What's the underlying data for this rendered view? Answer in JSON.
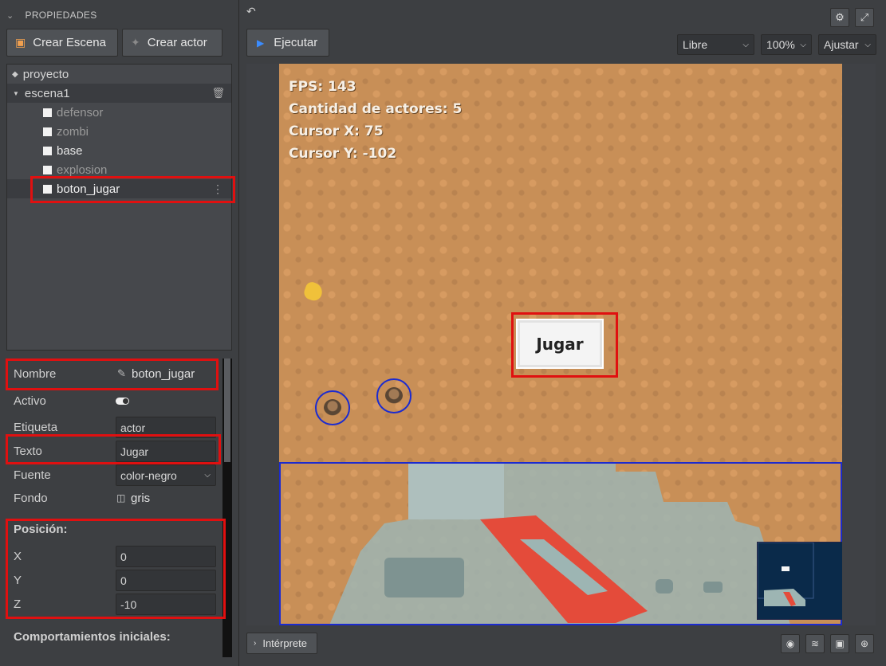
{
  "panel": {
    "title": "PROPIEDADES"
  },
  "toolbar": {
    "create_scene": "Crear Escena",
    "create_actor": "Crear actor"
  },
  "tree": {
    "project": "proyecto",
    "scene": "escena1",
    "actors": [
      {
        "name": "defensor",
        "dimmed": true
      },
      {
        "name": "zombi",
        "dimmed": true
      },
      {
        "name": "base",
        "dimmed": false
      },
      {
        "name": "explosion",
        "dimmed": true
      },
      {
        "name": "boton_jugar",
        "dimmed": false,
        "selected": true
      }
    ]
  },
  "properties": {
    "nombre_label": "Nombre",
    "nombre_value": "boton_jugar",
    "activo_label": "Activo",
    "activo_value": true,
    "etiqueta_label": "Etiqueta",
    "etiqueta_value": "actor",
    "texto_label": "Texto",
    "texto_value": "Jugar",
    "fuente_label": "Fuente",
    "fuente_value": "color-negro",
    "fondo_label": "Fondo",
    "fondo_value": "gris",
    "posicion_heading": "Posición:",
    "x_label": "X",
    "x_value": "0",
    "y_label": "Y",
    "y_value": "0",
    "z_label": "Z",
    "z_value": "-10",
    "comportamientos_heading": "Comportamientos iniciales:"
  },
  "canvas_toolbar": {
    "run_label": "Ejecutar",
    "mode_select": "Libre",
    "zoom_select": "100%",
    "fit_select": "Ajustar"
  },
  "game": {
    "fps": "FPS: 143",
    "actors_count": "Cantidad de actores: 5",
    "cursor_x": "Cursor X: 75",
    "cursor_y": "Cursor Y: -102",
    "button_text": "Jugar"
  },
  "bottom": {
    "interpreter_label": "Intérprete"
  },
  "colors": {
    "highlight": "#e01010",
    "actor_outline": "#1b2bd0",
    "run_icon": "#3b8cff"
  }
}
